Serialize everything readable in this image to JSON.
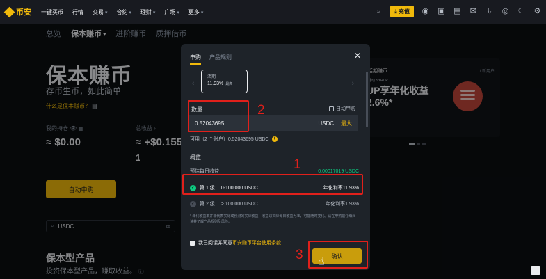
{
  "header": {
    "logo": "币安",
    "nav": [
      "一键买币",
      "行情",
      "交易",
      "合约",
      "理财",
      "广场",
      "更多"
    ],
    "recharge": "充值"
  },
  "subnav": [
    "总览",
    "保本赚币",
    "进阶赚币",
    "质押借币"
  ],
  "hero": {
    "title": "保本赚币",
    "subtitle": "存币生币，如此简单",
    "link": "什么是保本赚币？"
  },
  "stats": {
    "holdings_label": "我的持仓",
    "holdings_value": "≈ $0.00",
    "income_label": "总收益",
    "income_value": "≈ +$0.155",
    "income_extra": "1"
  },
  "auto_subscribe_button": "自动申购",
  "search": {
    "value": "USDC"
  },
  "section": {
    "title": "保本型产品",
    "subtitle": "投资保本型产品，赚取收益。"
  },
  "promo": {
    "title": "活期赚币",
    "tag": "/ 新用户",
    "small": "活动 SYRUP",
    "big_line1": "UP享年化收益",
    "big_line2": "2.6%*"
  },
  "modal": {
    "tabs": [
      "申购",
      "产品规则"
    ],
    "term": {
      "label": "活期",
      "rate": "11.93%",
      "rate_suffix": "最高"
    },
    "amount_label": "数量",
    "auto_subscribe": "自动申购",
    "amount_value": "0.52043695",
    "currency": "USDC",
    "max": "最大",
    "available": "可用（2 个账户）0.52043695 USDC",
    "overview_label": "概览",
    "daily_income_label": "预估每日收益",
    "daily_income_value": "0.00017019 USDC",
    "tier1_label": "第 1 级： 0-100,000 USDC",
    "tier1_rate": "年化利率11.93%",
    "tier2_label": "第 2 级： > 100,000 USDC",
    "tier2_rate": "年化利率1.93%",
    "note": "* 年化收益率并非代表实际或预测的实际收益，收益以实际每日收益为准，可能随时变化。请在申购前仔细阅读并了解产品规则及风险。",
    "agree_prefix": "我已阅读并同意",
    "agree_link": "币安赚币平台使用条款",
    "confirm": "确认"
  },
  "annotations": [
    "1",
    "2",
    "3"
  ],
  "colors": {
    "accent": "#f0b90b",
    "annotation": "#e0201b",
    "positive": "#0ecb81"
  }
}
